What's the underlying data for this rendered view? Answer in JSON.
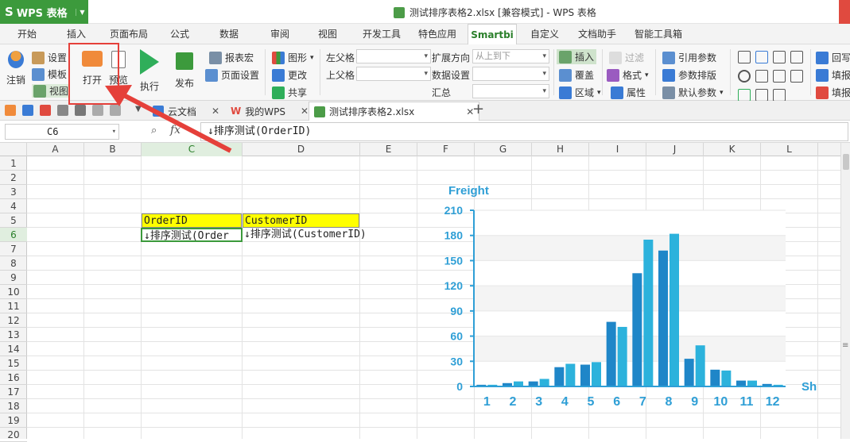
{
  "app": {
    "name": "WPS 表格",
    "title": "测试排序表格2.xlsx [兼容模式] - WPS 表格"
  },
  "ribbon_tabs": [
    "开始",
    "插入",
    "页面布局",
    "公式",
    "数据",
    "审阅",
    "视图",
    "开发工具",
    "特色应用",
    "Smartbi",
    "自定义",
    "文档助手",
    "智能工具箱"
  ],
  "active_tab": "Smartbi",
  "ribbon": {
    "logout": "注销",
    "settings": "设置",
    "template": "模板",
    "view": "视图",
    "open": "打开",
    "preview": "预览",
    "execute": "执行",
    "publish": "发布",
    "report_macro": "报表宏",
    "page_setup": "页面设置",
    "graphic": "图形",
    "change": "更改",
    "share": "共享",
    "left_parent": "左父格",
    "up_parent": "上父格",
    "expand_dir": "扩展方向",
    "expand_value": "从上到下",
    "data_setting": "数据设置",
    "summary": "汇总",
    "insert": "插入",
    "cover": "覆盖",
    "area": "区域",
    "filter": "过滤",
    "format": "格式",
    "attribute": "属性",
    "ref_param": "引用参数",
    "param_sort": "参数排版",
    "default_param": "默认参数",
    "writeback": "回写",
    "fill1": "填报",
    "fill2": "填报"
  },
  "doc_tabs": [
    {
      "label": "云文档"
    },
    {
      "label": "我的WPS"
    },
    {
      "label": "测试排序表格2.xlsx"
    }
  ],
  "formula_bar": {
    "name_box": "C6",
    "fx": "fx",
    "formula": "↓排序测试(OrderID)"
  },
  "columns": [
    "A",
    "B",
    "C",
    "D",
    "E",
    "F",
    "G",
    "H",
    "I",
    "J",
    "K",
    "L"
  ],
  "rows": [
    "1",
    "2",
    "3",
    "4",
    "5",
    "6",
    "7",
    "8",
    "9",
    "10",
    "11",
    "12",
    "13",
    "14",
    "15",
    "16",
    "17",
    "18",
    "19",
    "20"
  ],
  "cells": {
    "C5": "OrderID",
    "D5": "CustomerID",
    "C6": "↓排序测试(Order",
    "D6": "↓排序测试(CustomerID)"
  },
  "colors": {
    "accent": "#3c9a3c",
    "header_fill": "#ffff00",
    "bar_dark": "#1f86c8",
    "bar_light": "#2cb2dc",
    "axis": "#2f9fd6",
    "annotation": "#e5403a"
  },
  "chart_data": {
    "type": "bar",
    "title": "Freight",
    "xlabel": "Sh",
    "categories": [
      "1",
      "2",
      "3",
      "4",
      "5",
      "6",
      "7",
      "8",
      "9",
      "10",
      "11",
      "12"
    ],
    "ylim": [
      0,
      210
    ],
    "yticks": [
      0,
      30,
      60,
      90,
      120,
      150,
      180,
      210
    ],
    "series": [
      {
        "values": [
          2,
          4,
          6,
          23,
          26,
          77,
          135,
          162,
          33,
          20,
          7,
          3
        ]
      },
      {
        "values": [
          2,
          6,
          9,
          27,
          29,
          71,
          175,
          182,
          49,
          19,
          7,
          2
        ]
      }
    ],
    "grid": true
  }
}
